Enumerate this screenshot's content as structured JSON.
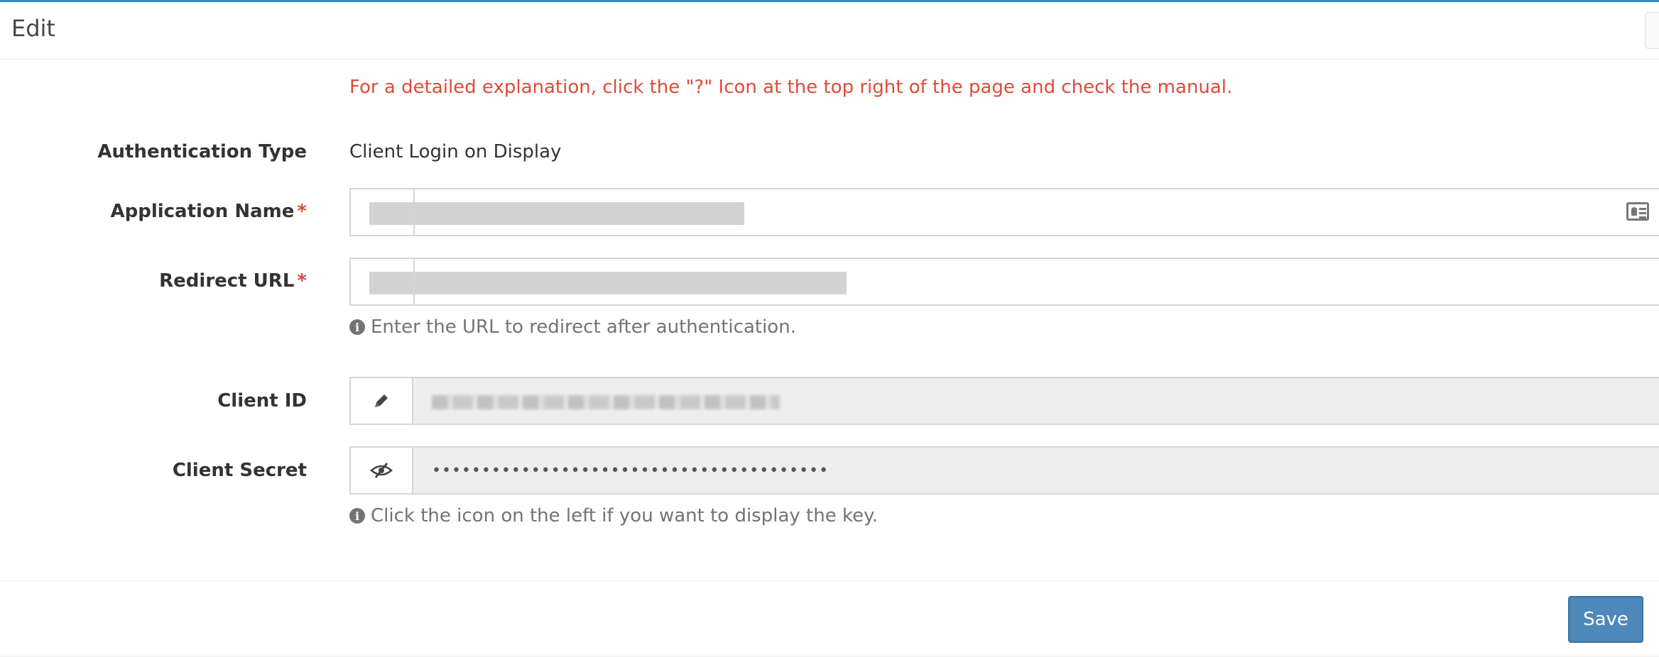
{
  "header": {
    "title": "Edit"
  },
  "notice": "For a detailed explanation, click the \"?\" Icon at the top right of the page and check the manual.",
  "form": {
    "auth_type": {
      "label": "Authentication Type",
      "value": "Client Login on Display"
    },
    "application_name": {
      "label": "Application Name",
      "required_mark": "*",
      "icon": "id-card-icon",
      "value": ""
    },
    "redirect_url": {
      "label": "Redirect URL",
      "required_mark": "*",
      "value": "",
      "help": "Enter the URL to redirect after authentication."
    },
    "client_id": {
      "label": "Client ID",
      "icon": "pencil-icon",
      "value": ""
    },
    "client_secret": {
      "label": "Client Secret",
      "icon": "eye-slash-icon",
      "value": "••••••••••••••••••••••••••••••••••••••••",
      "help": "Click the icon on the left if you want to display the key."
    }
  },
  "footer": {
    "save_label": "Save"
  },
  "colors": {
    "accent_top": "#3c8dbc",
    "notice": "#dd4b39",
    "save_button": "#4d88ba"
  }
}
